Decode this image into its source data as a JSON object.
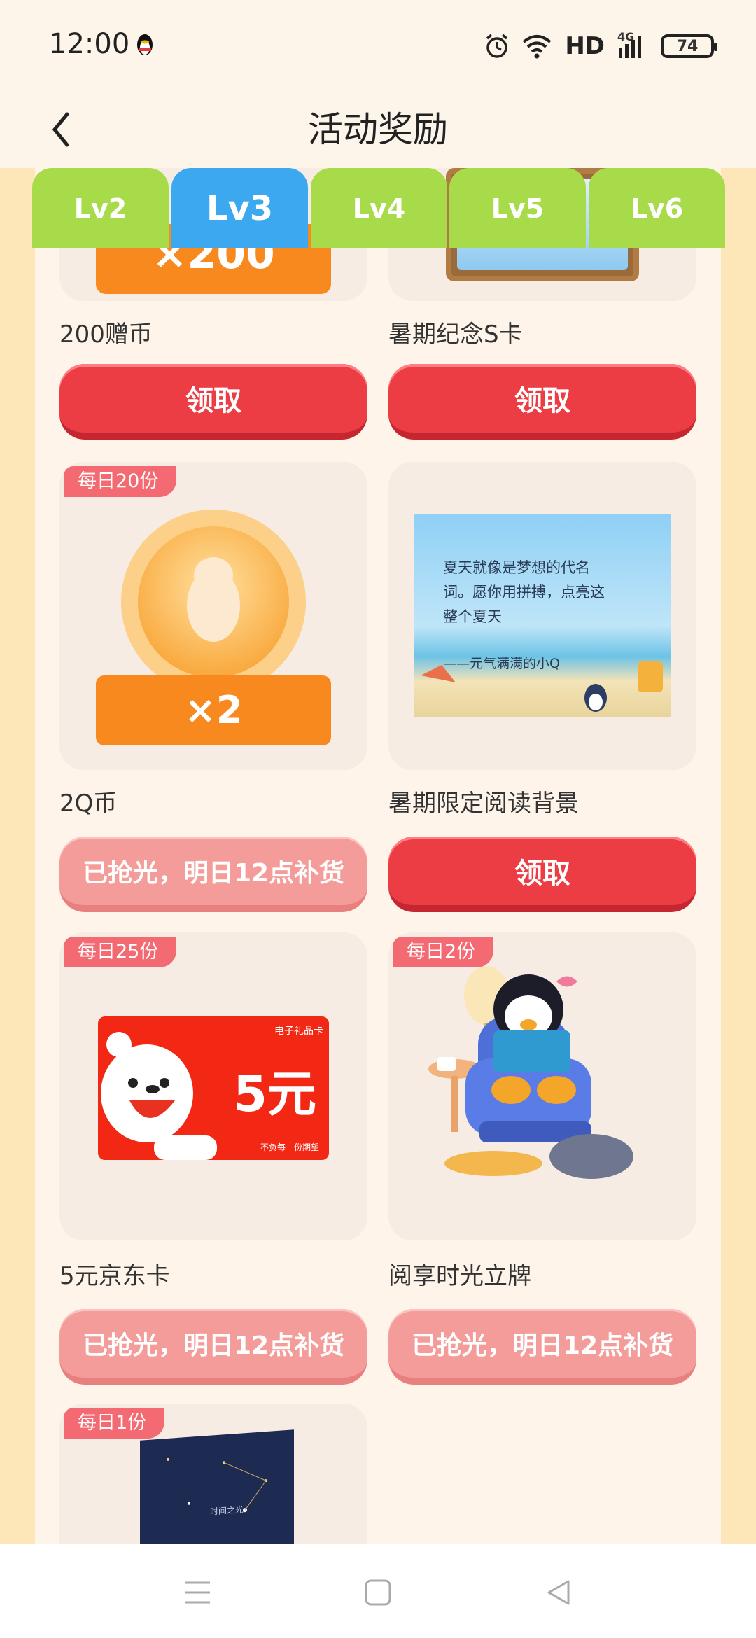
{
  "status_bar": {
    "time": "12:00",
    "network_label": "HD",
    "signal_label": "4G",
    "battery": "74"
  },
  "header": {
    "title": "活动奖励"
  },
  "tabs": [
    {
      "label": "Lv2",
      "active": false
    },
    {
      "label": "Lv3",
      "active": true
    },
    {
      "label": "Lv4",
      "active": false
    },
    {
      "label": "Lv5",
      "active": false
    },
    {
      "label": "Lv6",
      "active": false
    }
  ],
  "items": [
    {
      "name": "200赠币",
      "button": "领取",
      "state": "claim",
      "image_badge": "×200"
    },
    {
      "name": "暑期纪念S卡",
      "button": "领取",
      "state": "claim"
    },
    {
      "tag": "每日20份",
      "name": "2Q币",
      "image_badge": "×2",
      "button": "已抢光，明日12点补货",
      "state": "soldout"
    },
    {
      "name": "暑期限定阅读背景",
      "button": "领取",
      "state": "claim",
      "image_text": {
        "line1": "夏天就像是梦想的代名",
        "line2": "词。愿你用拼搏，点亮这",
        "line3": "整个夏天",
        "signature": "——元气满满的小Q"
      }
    },
    {
      "tag": "每日25份",
      "name": "5元京东卡",
      "button": "已抢光，明日12点补货",
      "state": "soldout",
      "card_text": {
        "header": "电子礼品卡",
        "amount": "5元",
        "slogan": "不负每一份期望"
      }
    },
    {
      "tag": "每日2份",
      "name": "阅享时光立牌",
      "button": "已抢光，明日12点补货",
      "state": "soldout"
    },
    {
      "tag": "每日1份",
      "book_title": "时间之光"
    }
  ],
  "colors": {
    "accent_red": "#ec3c44",
    "tab_green": "#a8db49",
    "tab_blue": "#3ba8f0",
    "tag_pink": "#f46a72",
    "coin_orange": "#f7891f"
  }
}
